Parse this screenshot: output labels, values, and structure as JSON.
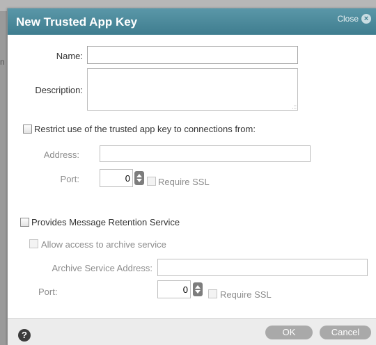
{
  "background": {
    "fragment": "n"
  },
  "dialog": {
    "title": "New Trusted App Key",
    "close_label": "Close",
    "name": {
      "label": "Name:",
      "value": ""
    },
    "description": {
      "label": "Description:",
      "value": "",
      "grip": ".::"
    },
    "restrict": {
      "label": "Restrict use of the trusted app key to connections from:",
      "checked": false,
      "address_label": "Address:",
      "address_value": "",
      "port_label": "Port:",
      "port_value": "0",
      "ssl_label": "Require SSL"
    },
    "retention": {
      "label": "Provides Message Retention Service",
      "checked": false,
      "allow_label": "Allow access to archive service",
      "archive_address_label": "Archive Service Address:",
      "archive_address_value": "",
      "port_label": "Port:",
      "port_value": "0",
      "ssl_label": "Require SSL"
    },
    "footer": {
      "help_icon": "?",
      "ok_label": "OK",
      "cancel_label": "Cancel"
    }
  }
}
